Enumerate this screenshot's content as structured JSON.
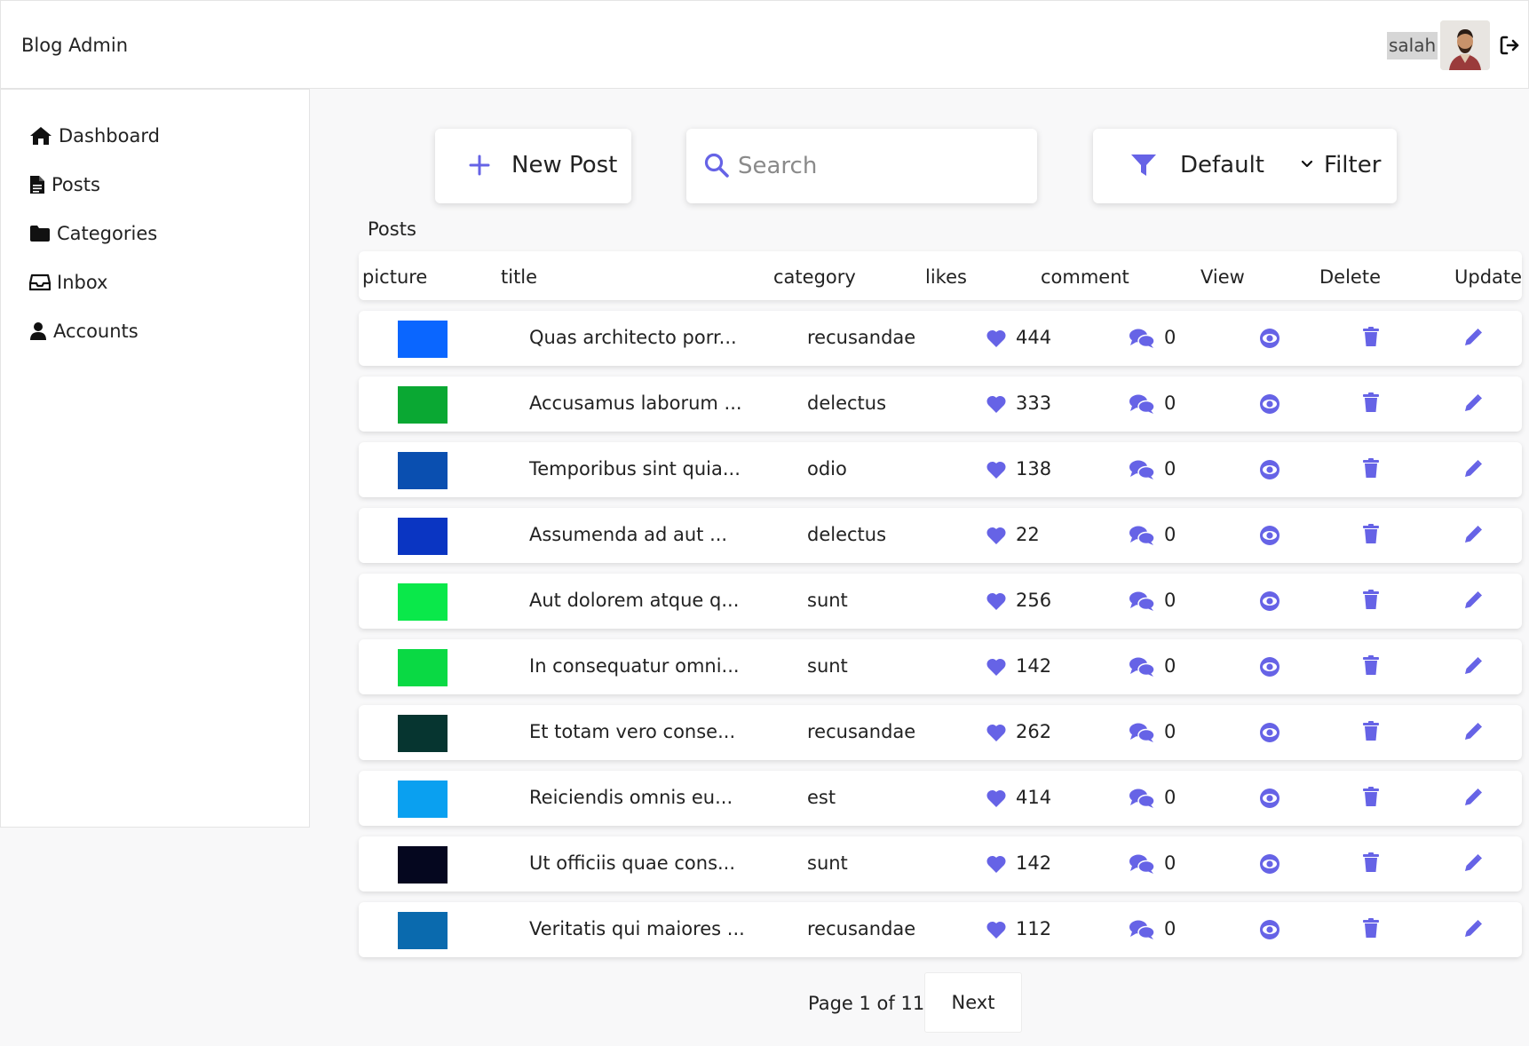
{
  "header": {
    "brand": "Blog Admin",
    "user": "salah"
  },
  "sidebar": {
    "items": [
      {
        "label": "Dashboard",
        "icon": "home-icon"
      },
      {
        "label": "Posts",
        "icon": "file-icon"
      },
      {
        "label": "Categories",
        "icon": "folder-icon"
      },
      {
        "label": "Inbox",
        "icon": "inbox-icon"
      },
      {
        "label": "Accounts",
        "icon": "user-icon"
      }
    ]
  },
  "toolbar": {
    "new_post": "New Post",
    "search_placeholder": "Search",
    "sort_value": "Default",
    "filter_label": "Filter"
  },
  "section_title": "Posts",
  "table": {
    "columns": [
      "picture",
      "title",
      "category",
      "likes",
      "comment",
      "View",
      "Delete",
      "Update"
    ],
    "rows": [
      {
        "color": "#0a66ff",
        "title": "Quas architecto porr...",
        "category": "recusandae",
        "likes": "444",
        "comments": "0"
      },
      {
        "color": "#0aa833",
        "title": "Accusamus laborum ...",
        "category": "delectus",
        "likes": "333",
        "comments": "0"
      },
      {
        "color": "#0a4fb0",
        "title": "Temporibus sint quia...",
        "category": "odio",
        "likes": "138",
        "comments": "0"
      },
      {
        "color": "#0a35c2",
        "title": "Assumenda ad aut ...",
        "category": "delectus",
        "likes": "22",
        "comments": "0"
      },
      {
        "color": "#0ae84a",
        "title": "Aut dolorem atque q...",
        "category": "sunt",
        "likes": "256",
        "comments": "0"
      },
      {
        "color": "#0ad944",
        "title": "In consequatur omni...",
        "category": "sunt",
        "likes": "142",
        "comments": "0"
      },
      {
        "color": "#063530",
        "title": "Et totam vero conse...",
        "category": "recusandae",
        "likes": "262",
        "comments": "0"
      },
      {
        "color": "#0aa0f0",
        "title": "Reiciendis omnis eu...",
        "category": "est",
        "likes": "414",
        "comments": "0"
      },
      {
        "color": "#05071f",
        "title": "Ut officiis quae cons...",
        "category": "sunt",
        "likes": "142",
        "comments": "0"
      },
      {
        "color": "#0a6aae",
        "title": "Veritatis qui maiores ...",
        "category": "recusandae",
        "likes": "112",
        "comments": "0"
      }
    ]
  },
  "pagination": {
    "info": "Page 1 of 11",
    "next": "Next"
  },
  "colors": {
    "accent": "#6663e6"
  }
}
